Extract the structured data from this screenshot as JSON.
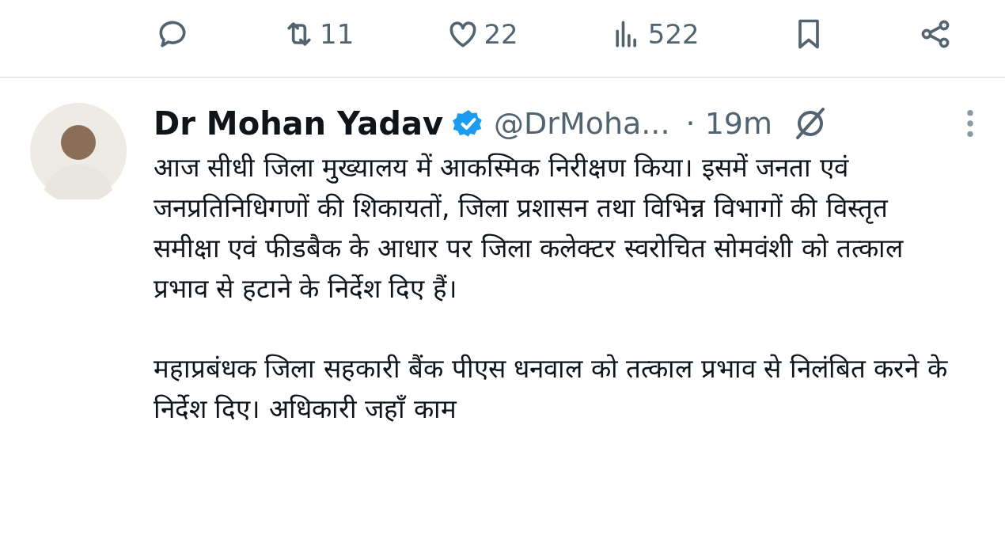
{
  "actions": [
    {
      "kind": "reply"
    },
    {
      "kind": "retweet",
      "count": "11"
    },
    {
      "kind": "like",
      "count": "22"
    },
    {
      "kind": "views",
      "count": "522"
    },
    {
      "kind": "bookmark"
    },
    {
      "kind": "share"
    }
  ],
  "tweet": {
    "author": "Dr Mohan Yadav",
    "verified": true,
    "handle": "@DrMoha...",
    "time": "· 19m",
    "paragraphs": [
      "आज सीधी जिला मुख्यालय में आकस्मिक निरीक्षण किया। इसमें जनता एवं जनप्रतिनिधिगणों की शिकायतों, जिला प्रशासन तथा विभिन्न विभागों की विस्तृत समीक्षा एवं फीडबैक के आधार पर जिला कलेक्टर स्वरोचित सोमवंशी को तत्काल प्रभाव से हटाने के निर्देश दिए हैं।",
      "महाप्रबंधक जिला सहकारी बैंक पीएस धनवाल को तत्काल प्रभाव से निलंबित करने के निर्देश दिए। अधिकारी जहाँ काम"
    ]
  }
}
